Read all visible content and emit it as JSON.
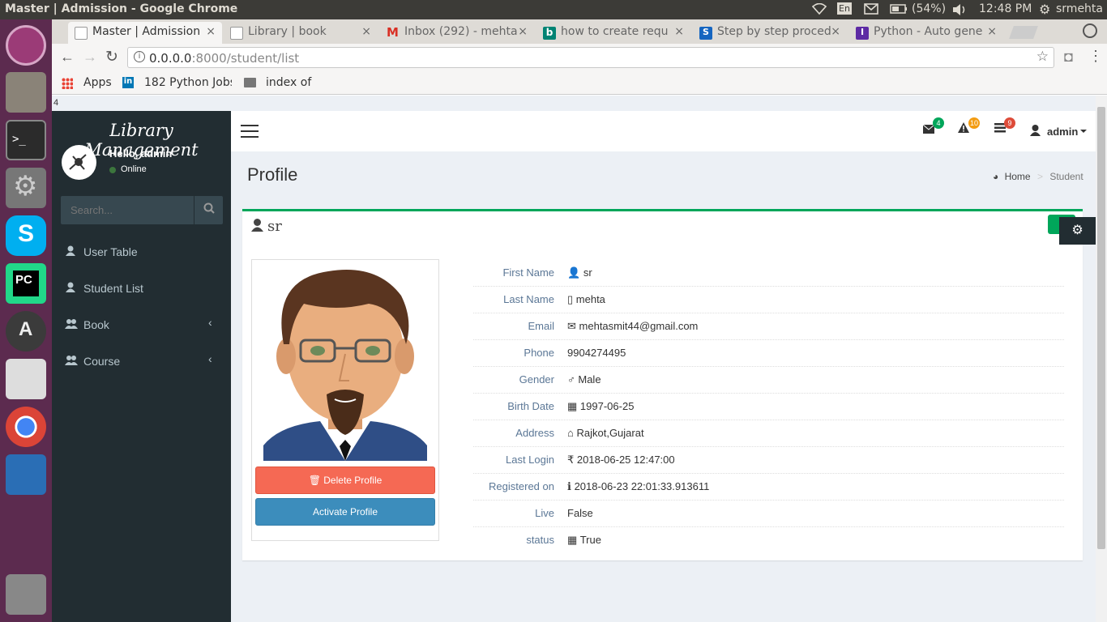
{
  "os": {
    "window_title": "Master | Admission - Google Chrome",
    "keyboard": "En",
    "battery": "(54%)",
    "time": "12:48 PM",
    "user": "srmehta"
  },
  "browser": {
    "tabs": [
      {
        "label": "Master | Admission",
        "color": "#ffffff"
      },
      {
        "label": "Library | book",
        "color": "#ffffff"
      },
      {
        "label": "Inbox (292) - mehta",
        "color": "#d93025"
      },
      {
        "label": "how to create requ",
        "color": "#008373"
      },
      {
        "label": "Step by step proced",
        "color": "#1565c0"
      },
      {
        "label": "Python - Auto gene",
        "color": "#5d2aa4"
      }
    ],
    "url_host": "0.0.0.0",
    "url_rest": ":8000/student/list",
    "bookmarks": {
      "apps": "Apps",
      "jobs": "182 Python Jobs",
      "index": "index of"
    }
  },
  "page_stray": "4",
  "sidebar": {
    "brand": "Library Management",
    "hello": "Hello, admin",
    "status": "Online",
    "search_placeholder": "Search...",
    "items": [
      {
        "label": "User Table"
      },
      {
        "label": "Student List"
      },
      {
        "label": "Book"
      },
      {
        "label": "Course"
      }
    ]
  },
  "header": {
    "mail_count": "4",
    "alert_count": "10",
    "task_count": "9",
    "user": "admin"
  },
  "content": {
    "title": "Profile",
    "breadcrumb_home": "Home",
    "breadcrumb_current": "Student"
  },
  "profile": {
    "name": "sr",
    "delete_label": "Delete Profile",
    "activate_label": "Activate Profile",
    "fields": [
      {
        "label": "First Name",
        "value": "sr"
      },
      {
        "label": "Last Name",
        "value": "mehta"
      },
      {
        "label": "Email",
        "value": "mehtasmit44@gmail.com"
      },
      {
        "label": "Phone",
        "value": "9904274495"
      },
      {
        "label": "Gender",
        "value": "Male"
      },
      {
        "label": "Birth Date",
        "value": "1997-06-25"
      },
      {
        "label": "Address",
        "value": "Rajkot,Gujarat"
      },
      {
        "label": "Last Login",
        "value": "2018-06-25 12:47:00"
      },
      {
        "label": "Registered on",
        "value": "2018-06-23 22:01:33.913611"
      },
      {
        "label": "Live",
        "value": "False"
      },
      {
        "label": "status",
        "value": "True"
      }
    ]
  }
}
